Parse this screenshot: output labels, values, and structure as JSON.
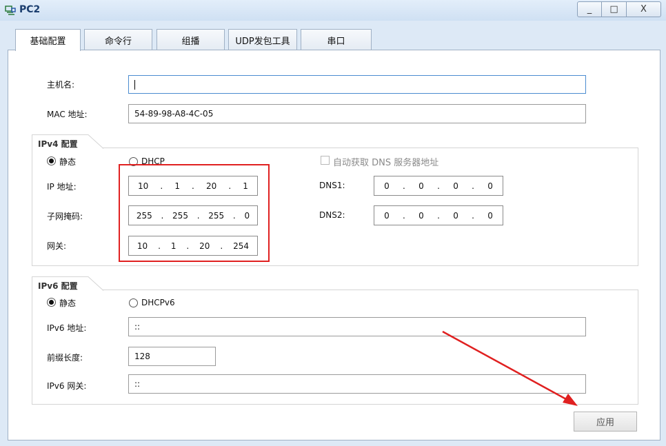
{
  "window": {
    "title": "PC2",
    "minimize": "_",
    "maximize": "□",
    "close": "X"
  },
  "tabs": [
    "基础配置",
    "命令行",
    "组播",
    "UDP发包工具",
    "串口"
  ],
  "basic": {
    "hostname_label": "主机名:",
    "hostname_value": "",
    "mac_label": "MAC 地址:",
    "mac_value": "54-89-98-A8-4C-05"
  },
  "ipv4": {
    "group_title": "IPv4 配置",
    "static_label": "静态",
    "dhcp_label": "DHCP",
    "auto_dns_label": "自动获取 DNS 服务器地址",
    "ip_label": "IP 地址:",
    "ip": [
      "10",
      "1",
      "20",
      "1"
    ],
    "mask_label": "子网掩码:",
    "mask": [
      "255",
      "255",
      "255",
      "0"
    ],
    "gateway_label": "网关:",
    "gateway": [
      "10",
      "1",
      "20",
      "254"
    ],
    "dns1_label": "DNS1:",
    "dns1": [
      "0",
      "0",
      "0",
      "0"
    ],
    "dns2_label": "DNS2:",
    "dns2": [
      "0",
      "0",
      "0",
      "0"
    ]
  },
  "ipv6": {
    "group_title": "IPv6 配置",
    "static_label": "静态",
    "dhcp_label": "DHCPv6",
    "addr_label": "IPv6 地址:",
    "addr_value": "::",
    "prefix_label": "前缀长度:",
    "prefix_value": "128",
    "gateway_label": "IPv6 网关:",
    "gateway_value": "::"
  },
  "apply_label": "应用",
  "colors": {
    "annotation": "#e02020",
    "title_text": "#1a3d6e"
  }
}
